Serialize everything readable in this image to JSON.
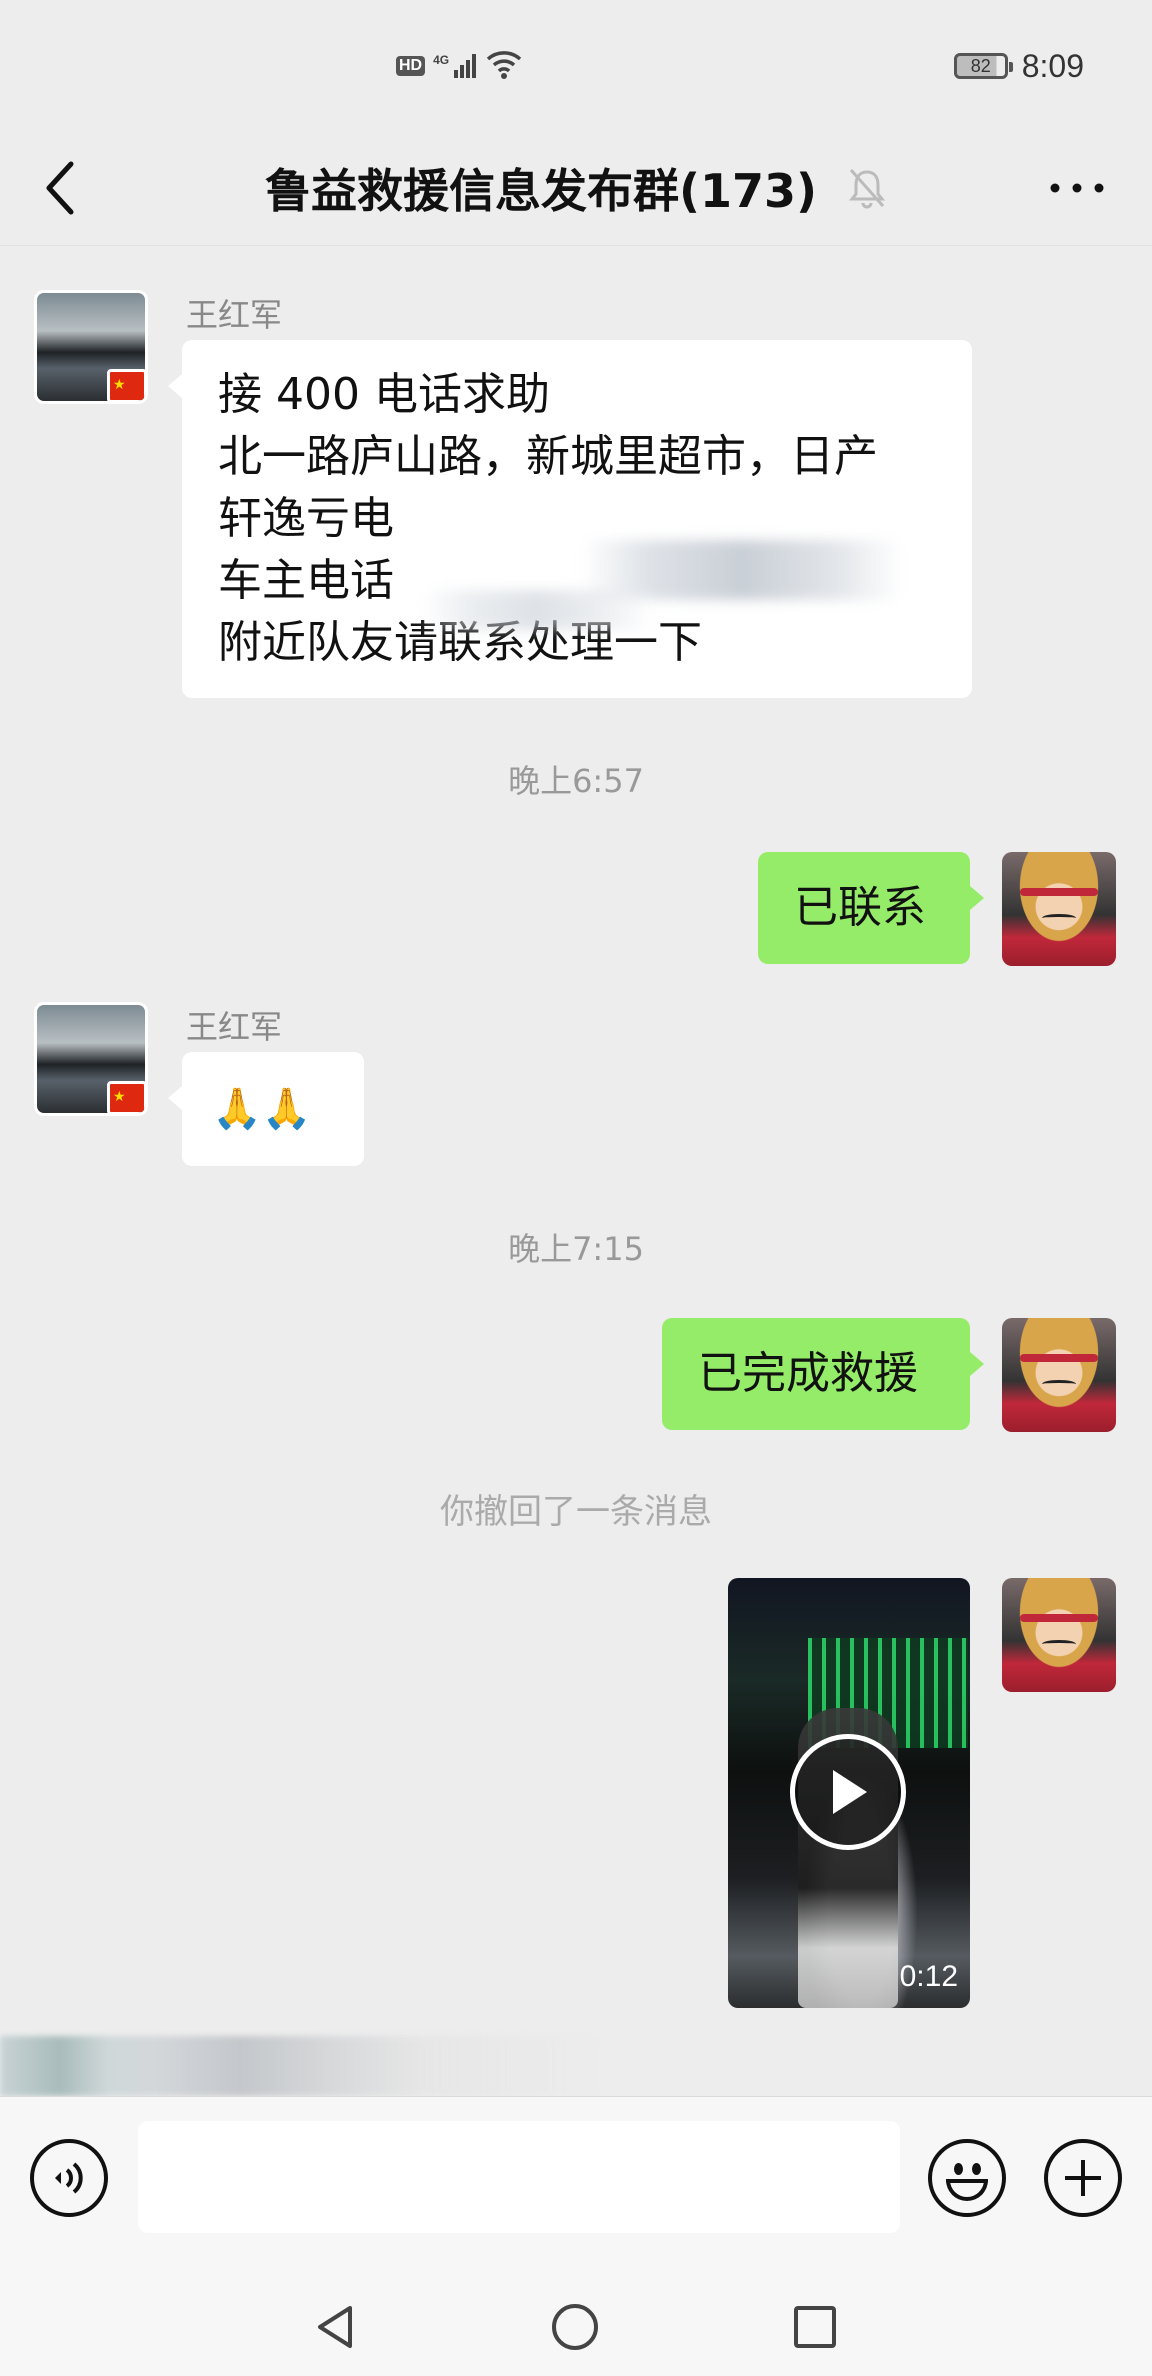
{
  "status_bar": {
    "network_badge": "HD",
    "signal_label": "4G",
    "battery_level": "82",
    "time": "8:09"
  },
  "header": {
    "title": "鲁益救援信息发布群(173)",
    "icons": [
      "back-arrow-icon",
      "mute-bell-icon",
      "more-dots-icon"
    ]
  },
  "messages": [
    {
      "side": "left",
      "sender": "王红军",
      "lines": [
        "接 400 电话求助",
        "北一路庐山路，新城里超市，日产",
        "轩逸亏电",
        "车主电话",
        "附近队友请联系处理一下"
      ]
    },
    {
      "type": "timestamp",
      "text": "晚上6:57"
    },
    {
      "side": "right",
      "text": "已联系"
    },
    {
      "side": "left",
      "sender": "王红军",
      "text": "🙏🙏"
    },
    {
      "type": "timestamp",
      "text": "晚上7:15"
    },
    {
      "side": "right",
      "text": "已完成救援"
    },
    {
      "type": "system",
      "text": "你撤回了一条消息"
    },
    {
      "side": "right",
      "type": "video",
      "duration": "0:12"
    }
  ],
  "input_bar": {
    "placeholder": "",
    "icons": [
      "voice-icon",
      "emoji-icon",
      "plus-icon"
    ]
  },
  "colors": {
    "background": "#ededed",
    "own_bubble": "#95ec69",
    "other_bubble": "#ffffff"
  }
}
